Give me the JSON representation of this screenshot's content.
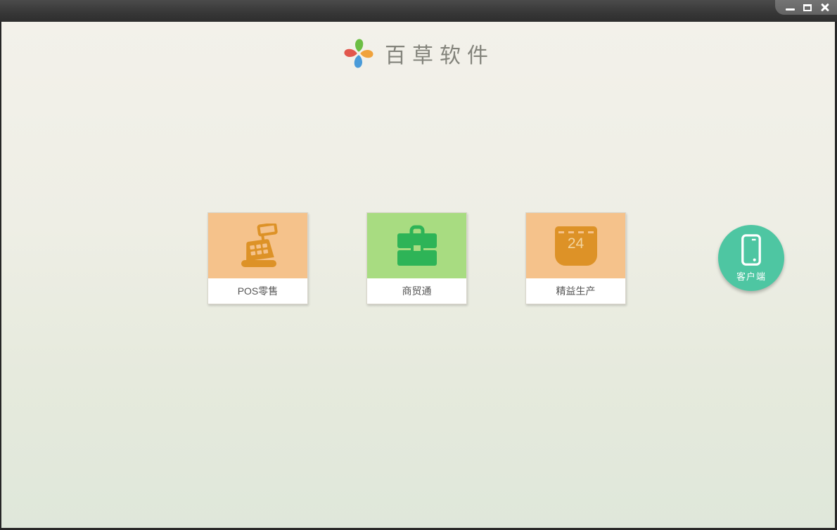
{
  "title_bar": {
    "controls": [
      {
        "name": "minimize-button",
        "icon": "minimize-icon"
      },
      {
        "name": "maximize-button",
        "icon": "maximize-icon"
      },
      {
        "name": "close-button",
        "icon": "close-icon"
      }
    ]
  },
  "header": {
    "app_title": "百草软件",
    "logo_icon": "pinwheel-logo",
    "logo_petal_colors": [
      "#6CBE44",
      "#F0A23B",
      "#4A9BD9",
      "#E2574D"
    ]
  },
  "products": [
    {
      "label": "POS零售",
      "icon": "cash-register-icon",
      "tile_color": "#F5C28B",
      "icon_color": "#DD9227"
    },
    {
      "label": "商贸通",
      "icon": "briefcase-icon",
      "tile_color": "#A8DC81",
      "icon_color": "#2EB457"
    },
    {
      "label": "精益生产",
      "icon": "calendar-icon",
      "calendar_day": "24",
      "tile_color": "#F5C28B",
      "icon_color": "#DD9227"
    }
  ],
  "client_button": {
    "label": "客户端",
    "icon": "smartphone-icon",
    "background_color": "#4EC6A2"
  },
  "colors": {
    "titlebar_top": "#4B4B4B",
    "titlebar_bottom": "#2E2E2E",
    "controls_panel": "#696969",
    "content_top": "#F3F1EA",
    "content_bottom": "#DFE7DA",
    "card_label_text": "#555555",
    "app_title_text": "#83837B",
    "window_border": "#262626"
  }
}
